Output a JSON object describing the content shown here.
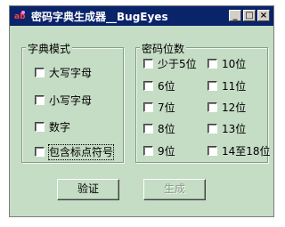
{
  "window": {
    "title": "密码字典生成器__BugEyes",
    "controls": {
      "minimize": "_",
      "maximize": "□",
      "close": "×"
    }
  },
  "dict_mode": {
    "title": "字典模式",
    "options": [
      {
        "label": "大写字母",
        "checked": false
      },
      {
        "label": "小写字母",
        "checked": false
      },
      {
        "label": "数字",
        "checked": false
      },
      {
        "label": "包含标点符号",
        "checked": false,
        "focused": true
      }
    ]
  },
  "password_length": {
    "title": "密码位数",
    "left_options": [
      {
        "label": "少于5位",
        "checked": false
      },
      {
        "label": "6位",
        "checked": false
      },
      {
        "label": "7位",
        "checked": false
      },
      {
        "label": "8位",
        "checked": false
      },
      {
        "label": "9位",
        "checked": false
      }
    ],
    "right_options": [
      {
        "label": "10位",
        "checked": false
      },
      {
        "label": "11位",
        "checked": false
      },
      {
        "label": "12位",
        "checked": false
      },
      {
        "label": "13位",
        "checked": false
      },
      {
        "label": "14至18位",
        "checked": false
      }
    ]
  },
  "buttons": {
    "verify": "验证",
    "generate": "生成",
    "generate_enabled": false
  },
  "colors": {
    "window_bg": "#c5dcc5",
    "titlebar_bg": "#0a246a",
    "title_text": "#ffffff"
  }
}
